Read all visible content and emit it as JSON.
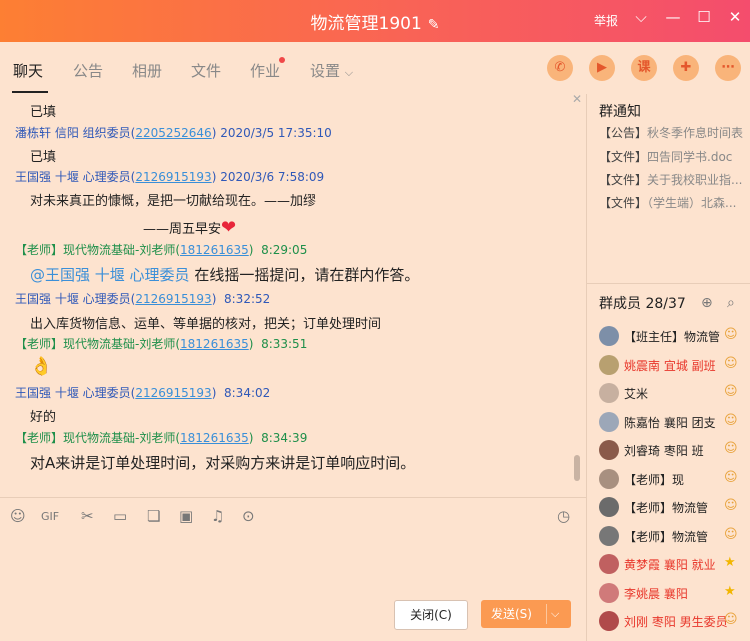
{
  "window": {
    "title": "物流管理1901",
    "report": "举报"
  },
  "tabs": [
    "聊天",
    "公告",
    "相册",
    "文件",
    "作业",
    "设置"
  ],
  "chat": [
    {
      "type": "text",
      "text": "已填"
    },
    {
      "type": "meta",
      "name": "潘栋轩 信阳 组织委员",
      "qq": "2205252646",
      "time": "2020/3/5 17:35:10"
    },
    {
      "type": "text",
      "text": "已填"
    },
    {
      "type": "meta",
      "name": "王国强 十堰 心理委员",
      "qq": "2126915193",
      "time": "2020/3/6 7:58:09"
    },
    {
      "type": "text",
      "text": "对未来真正的慷慨，是把一切献给现在。——加缪"
    },
    {
      "type": "text",
      "text": "——周五早安"
    },
    {
      "type": "meta",
      "name": "【老师】现代物流基础-刘老师",
      "qq": "181261635",
      "time": "8:29:05"
    },
    {
      "type": "mention",
      "mention": "@王国强 十堰 心理委员",
      "text": " 在线摇一摇提问，请在群内作答。"
    },
    {
      "type": "meta",
      "name": "王国强 十堰 心理委员",
      "qq": "2126915193",
      "time": "8:32:52"
    },
    {
      "type": "text",
      "text": "出入库货物信息、运单、等单据的核对，把关；订单处理时间"
    },
    {
      "type": "meta",
      "name": "【老师】现代物流基础-刘老师",
      "qq": "181261635",
      "time": "8:33:51"
    },
    {
      "type": "emoji",
      "text": "👌"
    },
    {
      "type": "meta",
      "name": "王国强 十堰 心理委员",
      "qq": "2126915193",
      "time": "8:34:02"
    },
    {
      "type": "text",
      "text": "好的"
    },
    {
      "type": "meta",
      "name": "【老师】现代物流基础-刘老师",
      "qq": "181261635",
      "time": "8:34:39"
    },
    {
      "type": "text",
      "text": "对A来讲是订单处理时间，对采购方来讲是订单响应时间。"
    }
  ],
  "buttons": {
    "close": "关闭(C)",
    "send": "发送(S)"
  },
  "notice": {
    "title": "群通知",
    "items": [
      {
        "cat": "【公告】",
        "text": "秋冬季作息时间表"
      },
      {
        "cat": "【文件】",
        "text": "四告同学书.doc"
      },
      {
        "cat": "【文件】",
        "text": "关于我校职业指..."
      },
      {
        "cat": "【文件】",
        "text": "（学生端）北森..."
      }
    ]
  },
  "members": {
    "title": "群成员 28/37",
    "list": [
      {
        "name": "【班主任】物流管",
        "color": "#222222"
      },
      {
        "name": "姚震南 宜城 副班",
        "color": "#e8362a"
      },
      {
        "name": "艾米",
        "color": "#222222"
      },
      {
        "name": "陈嘉怡 襄阳 团支",
        "color": "#222222"
      },
      {
        "name": "刘睿琦  枣阳  班",
        "color": "#222222"
      },
      {
        "name": "【老师】现",
        "color": "#222222"
      },
      {
        "name": "【老师】物流管",
        "color": "#222222"
      },
      {
        "name": "【老师】物流管",
        "color": "#222222"
      },
      {
        "name": "黄梦霞  襄阳 就业",
        "color": "#e8362a"
      },
      {
        "name": "李姚晨 襄阳",
        "color": "#e8362a"
      },
      {
        "name": "刘刚  枣阳  男生委员",
        "color": "#e8362a"
      }
    ]
  },
  "colors": {
    "accent": "#fd7f33",
    "chat_bg": "#fde3cf"
  }
}
